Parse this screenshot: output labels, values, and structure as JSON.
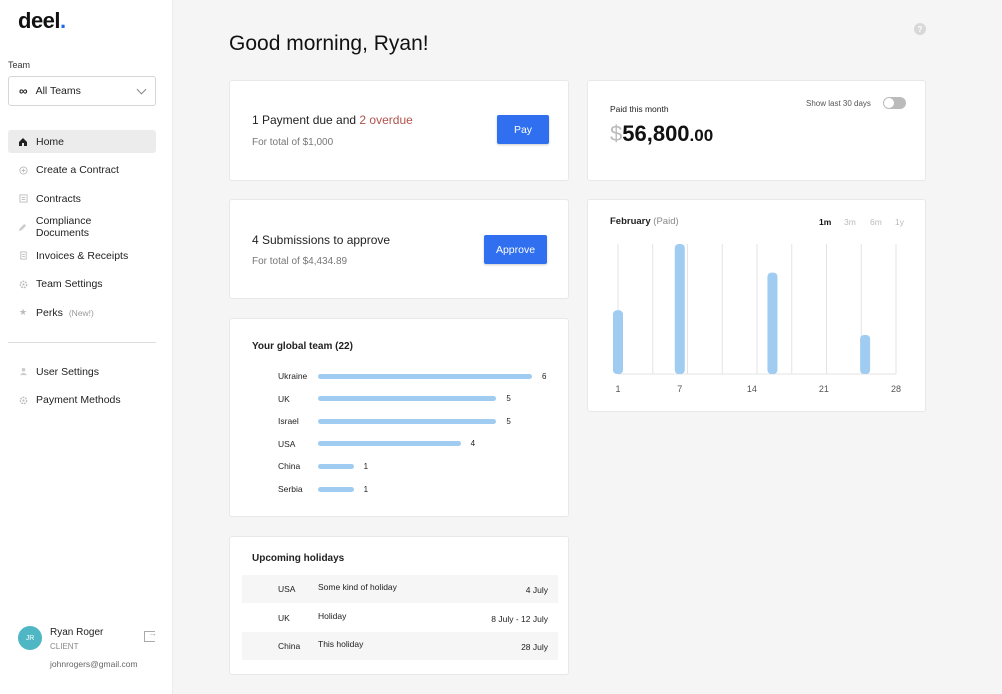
{
  "logo": {
    "text": "deel",
    "dot": "."
  },
  "sidebar": {
    "team_label": "Team",
    "team_select": {
      "value": "All Teams",
      "icon": "infinity-icon"
    },
    "nav": [
      {
        "label": "Home",
        "icon": "home-icon",
        "active": true
      },
      {
        "label": "Create a Contract",
        "icon": "plus-circle-icon"
      },
      {
        "label": "Contracts",
        "icon": "document-icon"
      },
      {
        "label": "Compliance Documents",
        "icon": "pen-icon"
      },
      {
        "label": "Invoices & Receipts",
        "icon": "receipt-icon"
      },
      {
        "label": "Team Settings",
        "icon": "gear-icon"
      },
      {
        "label": "Perks",
        "icon": "star-icon",
        "badge": "(New!)"
      }
    ],
    "nav2": [
      {
        "label": "User Settings",
        "icon": "user-icon"
      },
      {
        "label": "Payment Methods",
        "icon": "gear-icon"
      }
    ],
    "user": {
      "initials": "JR",
      "name": "Ryan Roger",
      "role": "CLIENT",
      "email": "johnrogers@gmail.com"
    }
  },
  "main": {
    "greeting": "Good morning, Ryan!",
    "payment": {
      "title_prefix": "1 Payment due and ",
      "overdue": "2 overdue",
      "subtitle": "For total of $1,000",
      "button": "Pay"
    },
    "submissions": {
      "title": "4 Submissions to approve",
      "subtitle": "For total of $4,434.89",
      "button": "Approve"
    },
    "global_team": {
      "title": "Your global team (22)",
      "rows": [
        {
          "country": "Ukraine",
          "count": 6,
          "label": "6"
        },
        {
          "country": "UK",
          "count": 5,
          "label": "5"
        },
        {
          "country": "Israel",
          "count": 5,
          "label": "5"
        },
        {
          "country": "USA",
          "count": 4,
          "label": "4"
        },
        {
          "country": "China",
          "count": 1,
          "label": "1"
        },
        {
          "country": "Serbia",
          "count": 1,
          "label": "1"
        }
      ]
    },
    "holidays": {
      "title": "Upcoming holidays",
      "rows": [
        {
          "country": "USA",
          "name": "Some kind of holiday",
          "date": "4 July"
        },
        {
          "country": "UK",
          "name": "Holiday",
          "date": "8 July - 12 July"
        },
        {
          "country": "China",
          "name": "This holiday",
          "date": "28 July"
        }
      ]
    },
    "paid": {
      "label": "Paid this month",
      "currency": "$",
      "amount": "56,800",
      "cents": ".00",
      "toggle_label": "Show last 30 days",
      "toggle_on": false
    },
    "chart": {
      "title": "February",
      "title_suffix": "(Paid)",
      "ranges": [
        "1m",
        "3m",
        "6m",
        "1y"
      ],
      "active_range": "1m"
    }
  },
  "chart_data": {
    "type": "bar",
    "title": "February (Paid)",
    "x_ticks": [
      "1",
      "7",
      "14",
      "21",
      "28"
    ],
    "xlim": [
      1,
      28
    ],
    "x": [
      1,
      7,
      16,
      25
    ],
    "values": [
      0.49,
      1.0,
      0.78,
      0.3
    ],
    "color": "#9fccf0"
  }
}
